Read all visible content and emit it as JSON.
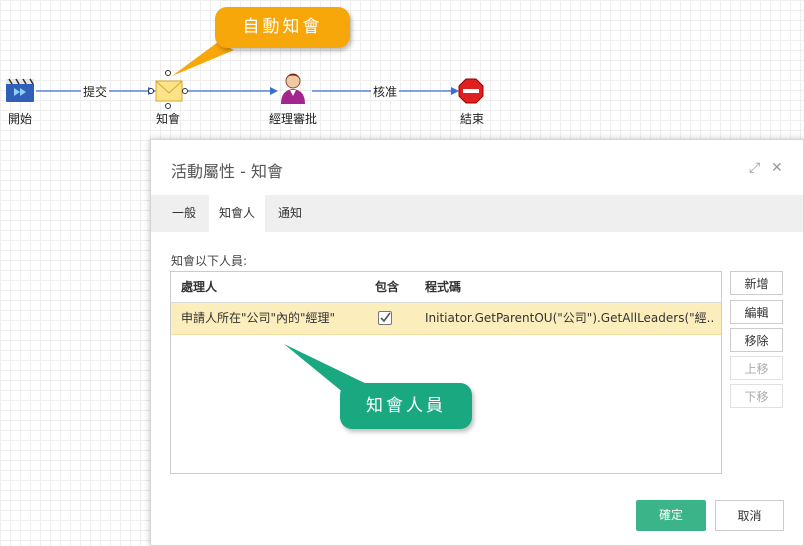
{
  "workflow": {
    "nodes": [
      {
        "id": "start",
        "label": "開始",
        "icon": "start-icon"
      },
      {
        "id": "notify",
        "label": "知會",
        "icon": "envelope-icon"
      },
      {
        "id": "approve",
        "label": "經理審批",
        "icon": "person-icon"
      },
      {
        "id": "end",
        "label": "結束",
        "icon": "stop-icon"
      }
    ],
    "edges": [
      {
        "label": "提交"
      },
      {
        "label": ""
      },
      {
        "label": "核准"
      }
    ]
  },
  "callouts": {
    "auto_notify": "自動知會",
    "notify_people": "知會人員"
  },
  "dialog": {
    "title": "活動屬性 - 知會",
    "tabs": [
      "一般",
      "知會人",
      "通知"
    ],
    "active_tab": "知會人",
    "section_label": "知會以下人員:",
    "grid": {
      "headers": [
        "處理人",
        "包含",
        "程式碼"
      ],
      "rows": [
        {
          "handler": "申請人所在\"公司\"內的\"經理\"",
          "include": true,
          "code": "Initiator.GetParentOU(\"公司\").GetAllLeaders(\"經..."
        }
      ]
    },
    "side_buttons": [
      {
        "label": "新增",
        "enabled": true
      },
      {
        "label": "編輯",
        "enabled": true
      },
      {
        "label": "移除",
        "enabled": true
      },
      {
        "label": "上移",
        "enabled": false
      },
      {
        "label": "下移",
        "enabled": false
      }
    ],
    "ok_label": "確定",
    "cancel_label": "取消"
  },
  "colors": {
    "accent_green": "#3cb48a",
    "callout_orange": "#f7a70a",
    "callout_green": "#1aa881",
    "selected_row": "#fbeebc"
  }
}
